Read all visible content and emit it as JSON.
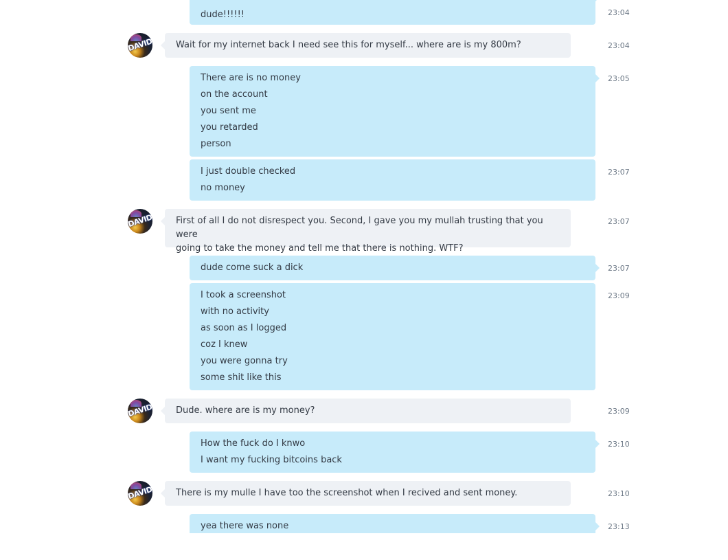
{
  "contact": {
    "avatar_text": "DAVID",
    "avatar_icon": "user-avatar-icon"
  },
  "colors": {
    "incoming_bubble": "#eef1f5",
    "outgoing_bubble": "#c7ebfa",
    "timestamp": "#6b7785",
    "text": "#333a44"
  },
  "messages": [
    {
      "from": "me",
      "lines": [
        "dude!!!!!!"
      ],
      "time": "23:04"
    },
    {
      "from": "them",
      "lines": [
        "Wait for my internet back I need see this for myself... where are is my 800m?"
      ],
      "time": "23:04"
    },
    {
      "from": "me",
      "lines": [
        "There are is no money",
        "on the account",
        "you sent me",
        "you retarded",
        "person"
      ],
      "time": "23:05"
    },
    {
      "from": "me",
      "lines": [
        "I just double checked",
        "no money"
      ],
      "time": "23:07"
    },
    {
      "from": "them",
      "lines": [
        "First of all I do not disrespect you. Second, I gave you my mullah trusting that you were",
        "going to take the money and tell me that there is nothing. WTF?"
      ],
      "time": "23:07"
    },
    {
      "from": "me",
      "lines": [
        "dude come suck a dick"
      ],
      "time": "23:07"
    },
    {
      "from": "me",
      "lines": [
        "I took a screenshot",
        "with no activity",
        "as soon as I logged",
        "coz I knew",
        "you were gonna try",
        "some shit like this"
      ],
      "time": "23:09"
    },
    {
      "from": "them",
      "lines": [
        "Dude. where are is my money?"
      ],
      "time": "23:09"
    },
    {
      "from": "me",
      "lines": [
        "How the fuck do I knwo",
        "I want my fucking bitcoins back"
      ],
      "time": "23:10"
    },
    {
      "from": "them",
      "lines": [
        "There is my mulle I have too the screenshot when I recived and sent money."
      ],
      "time": "23:10"
    },
    {
      "from": "me",
      "lines": [
        "yea there was none"
      ],
      "time": "23:13"
    }
  ]
}
